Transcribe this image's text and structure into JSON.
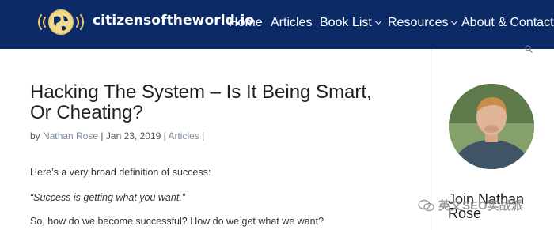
{
  "header": {
    "site_name": "citizensoftheworld.io",
    "nav": {
      "home": "Home",
      "articles": "Articles",
      "book_list": "Book List",
      "resources": "Resources",
      "about": "About & Contact"
    }
  },
  "post": {
    "title": "Hacking The System – Is It Being Smart, Or Cheating?",
    "meta": {
      "by": "by",
      "author": "Nathan Rose",
      "sep1": "|",
      "date": "Jan 23, 2019",
      "sep2": "|",
      "category": "Articles",
      "sep3": "|"
    },
    "p1": "Here’s a very broad definition of success:",
    "p2_prefix": "“Success is ",
    "p2_underlined": "getting what you want",
    "p2_suffix": ".”",
    "p3": "So, how do we become successful? How do we get what we want?"
  },
  "sidebar": {
    "join_heading": "Join Nathan Rose"
  },
  "watermark": {
    "text": "英文SEO实战派"
  },
  "colors": {
    "header_bg": "#0c2a66",
    "link": "#7c8a99"
  },
  "icons": {
    "logo": "globe-broadcast-icon",
    "search": "search-icon",
    "nav_dropdown": "chevron-down-icon",
    "watermark": "wechat-icon"
  }
}
